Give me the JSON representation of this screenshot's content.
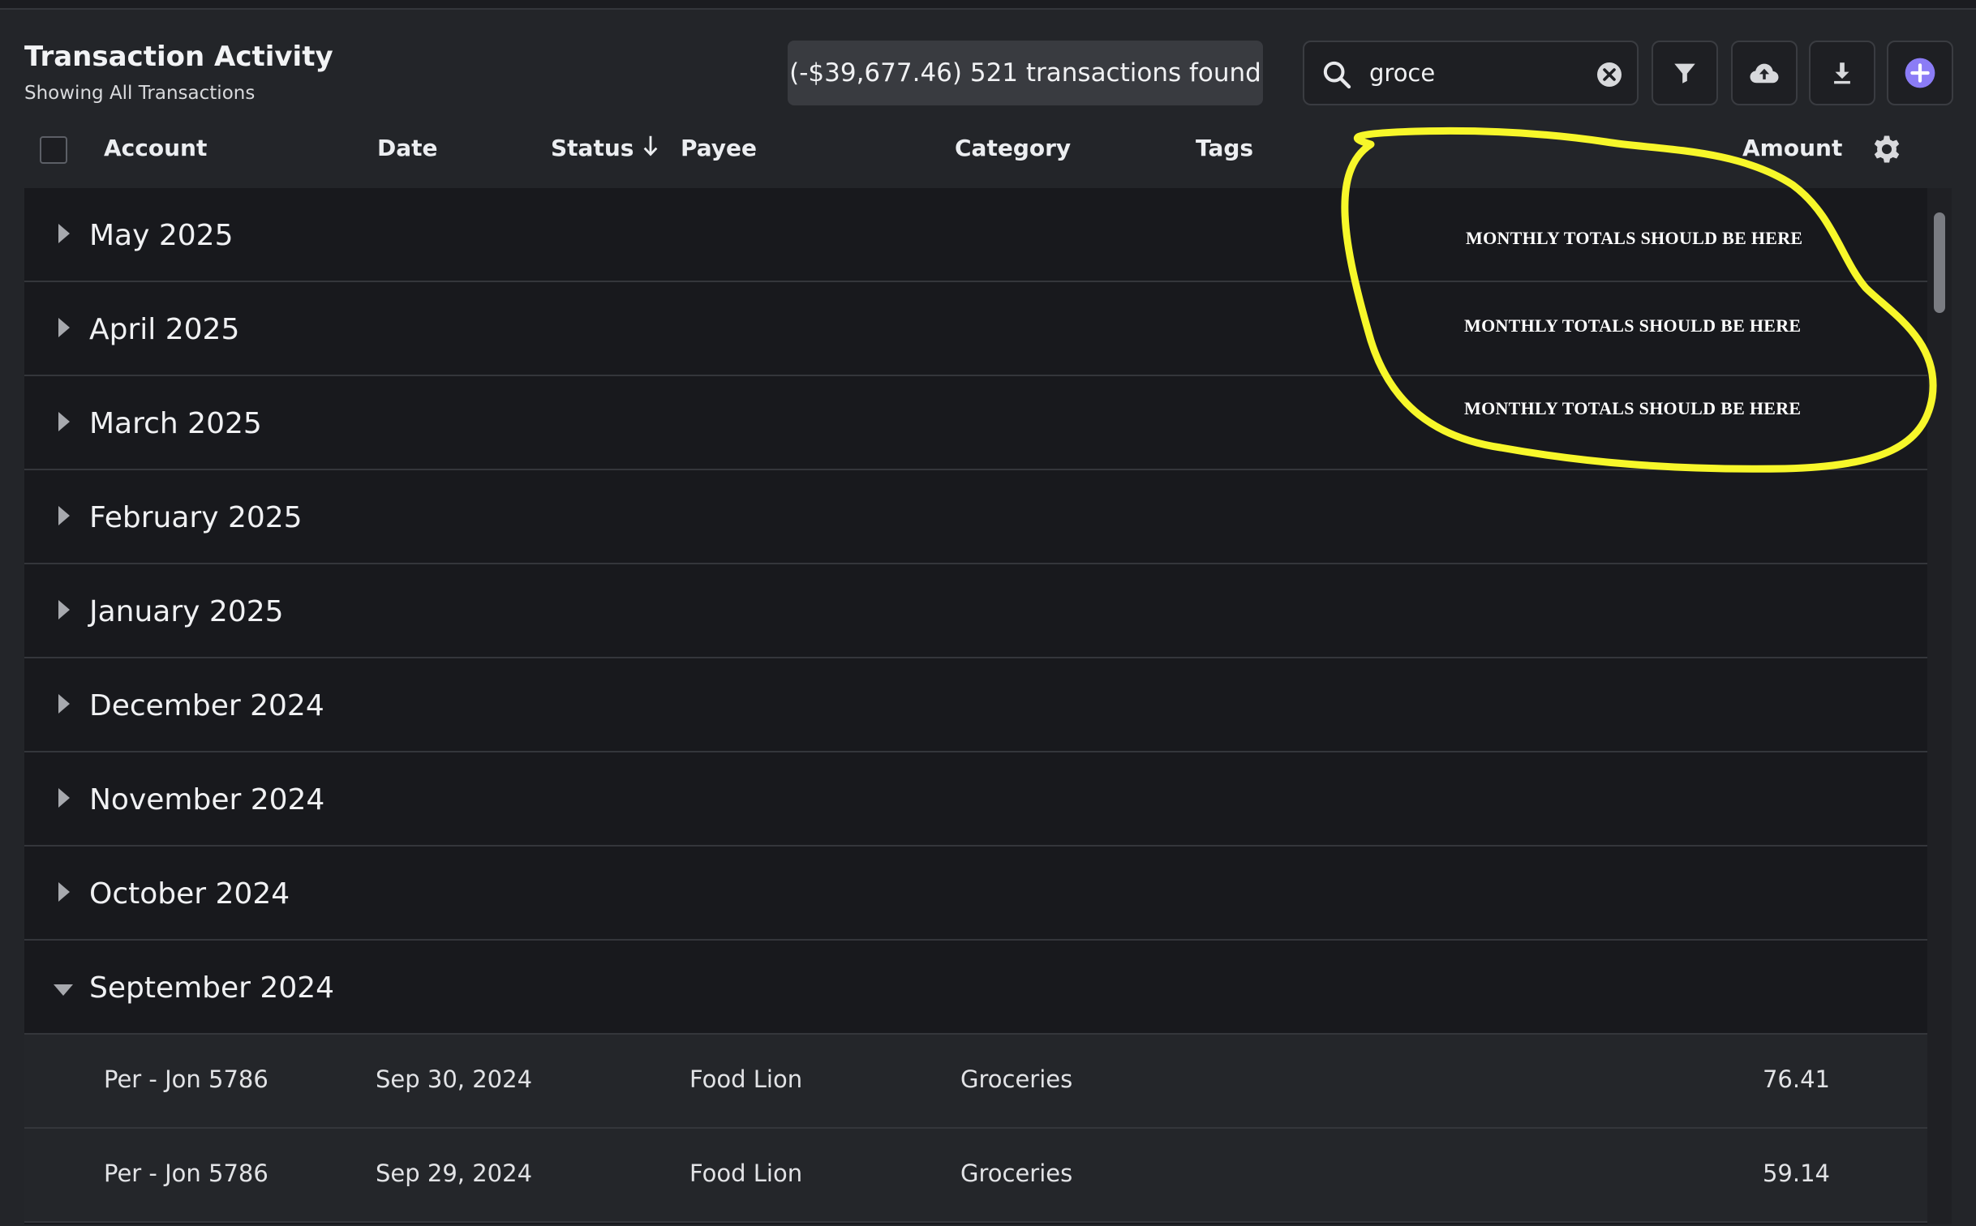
{
  "header": {
    "title": "Transaction Activity",
    "subtitle": "Showing All Transactions",
    "summary": "(-$39,677.46) 521 transactions found"
  },
  "search": {
    "value": "groce"
  },
  "toolbar": {
    "filter_icon": "filter-icon",
    "upload_icon": "cloud-upload-icon",
    "download_icon": "download-icon",
    "add_icon": "plus-circle-icon",
    "accent": "#8b7cf6"
  },
  "columns": {
    "account": "Account",
    "date": "Date",
    "status": "Status",
    "payee": "Payee",
    "category": "Category",
    "tags": "Tags",
    "amount": "Amount"
  },
  "months": [
    {
      "label": "May 2025",
      "expanded": false
    },
    {
      "label": "April 2025",
      "expanded": false
    },
    {
      "label": "March 2025",
      "expanded": false
    },
    {
      "label": "February 2025",
      "expanded": false
    },
    {
      "label": "January 2025",
      "expanded": false
    },
    {
      "label": "December 2024",
      "expanded": false
    },
    {
      "label": "November 2024",
      "expanded": false
    },
    {
      "label": "October 2024",
      "expanded": false
    },
    {
      "label": "September 2024",
      "expanded": true
    }
  ],
  "transactions": [
    {
      "account": "Per - Jon 5786",
      "date": "Sep 30, 2024",
      "payee": "Food Lion",
      "category": "Groceries",
      "amount": "76.41"
    },
    {
      "account": "Per - Jon 5786",
      "date": "Sep 29, 2024",
      "payee": "Food Lion",
      "category": "Groceries",
      "amount": "59.14"
    }
  ],
  "annotation": {
    "color": "#f7f72a",
    "notes": [
      "MONTHLY TOTALS SHOULD BE HERE",
      "MONTHLY TOTALS SHOULD BE HERE",
      "MONTHLY TOTALS SHOULD BE HERE"
    ]
  }
}
